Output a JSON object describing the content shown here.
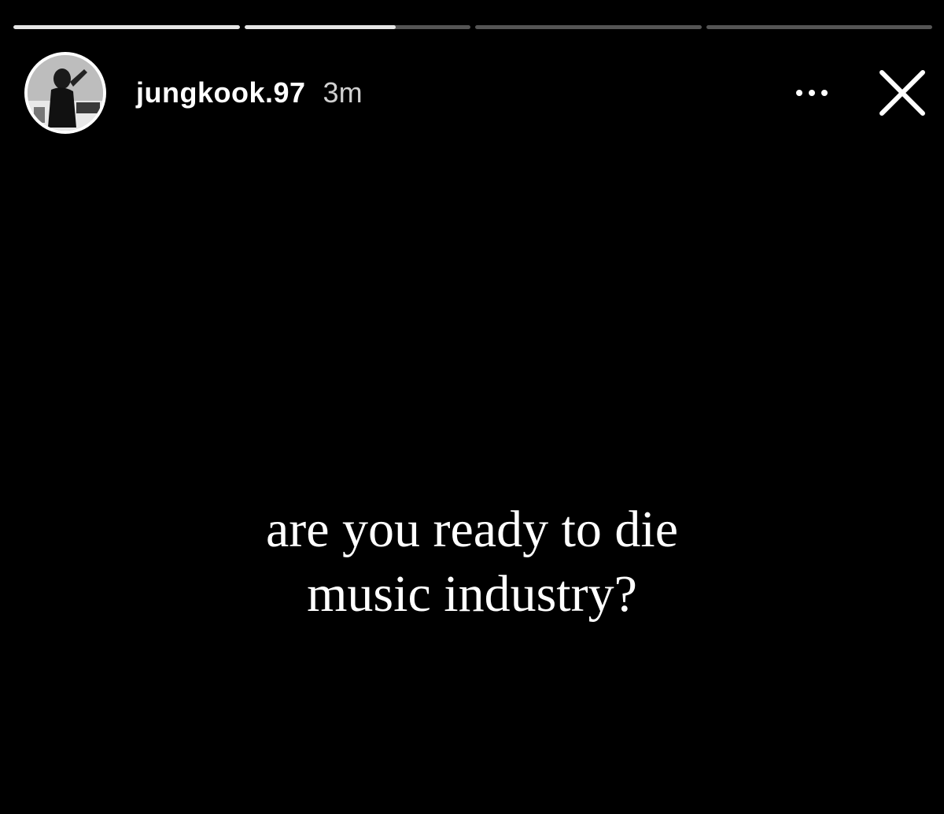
{
  "story": {
    "progress": [
      1.0,
      0.67,
      0.0,
      0.0
    ],
    "user": {
      "username": "jungkook.97",
      "timestamp": "3m"
    },
    "controls": {
      "more_icon": "more-horizontal-icon",
      "close_icon": "close-icon"
    },
    "caption": {
      "line1": "are you ready to die",
      "line2": "music industry?"
    },
    "colors": {
      "background": "#000000",
      "text": "#ffffff",
      "progress_track": "#555555",
      "progress_fill": "#e6e6e6"
    }
  }
}
